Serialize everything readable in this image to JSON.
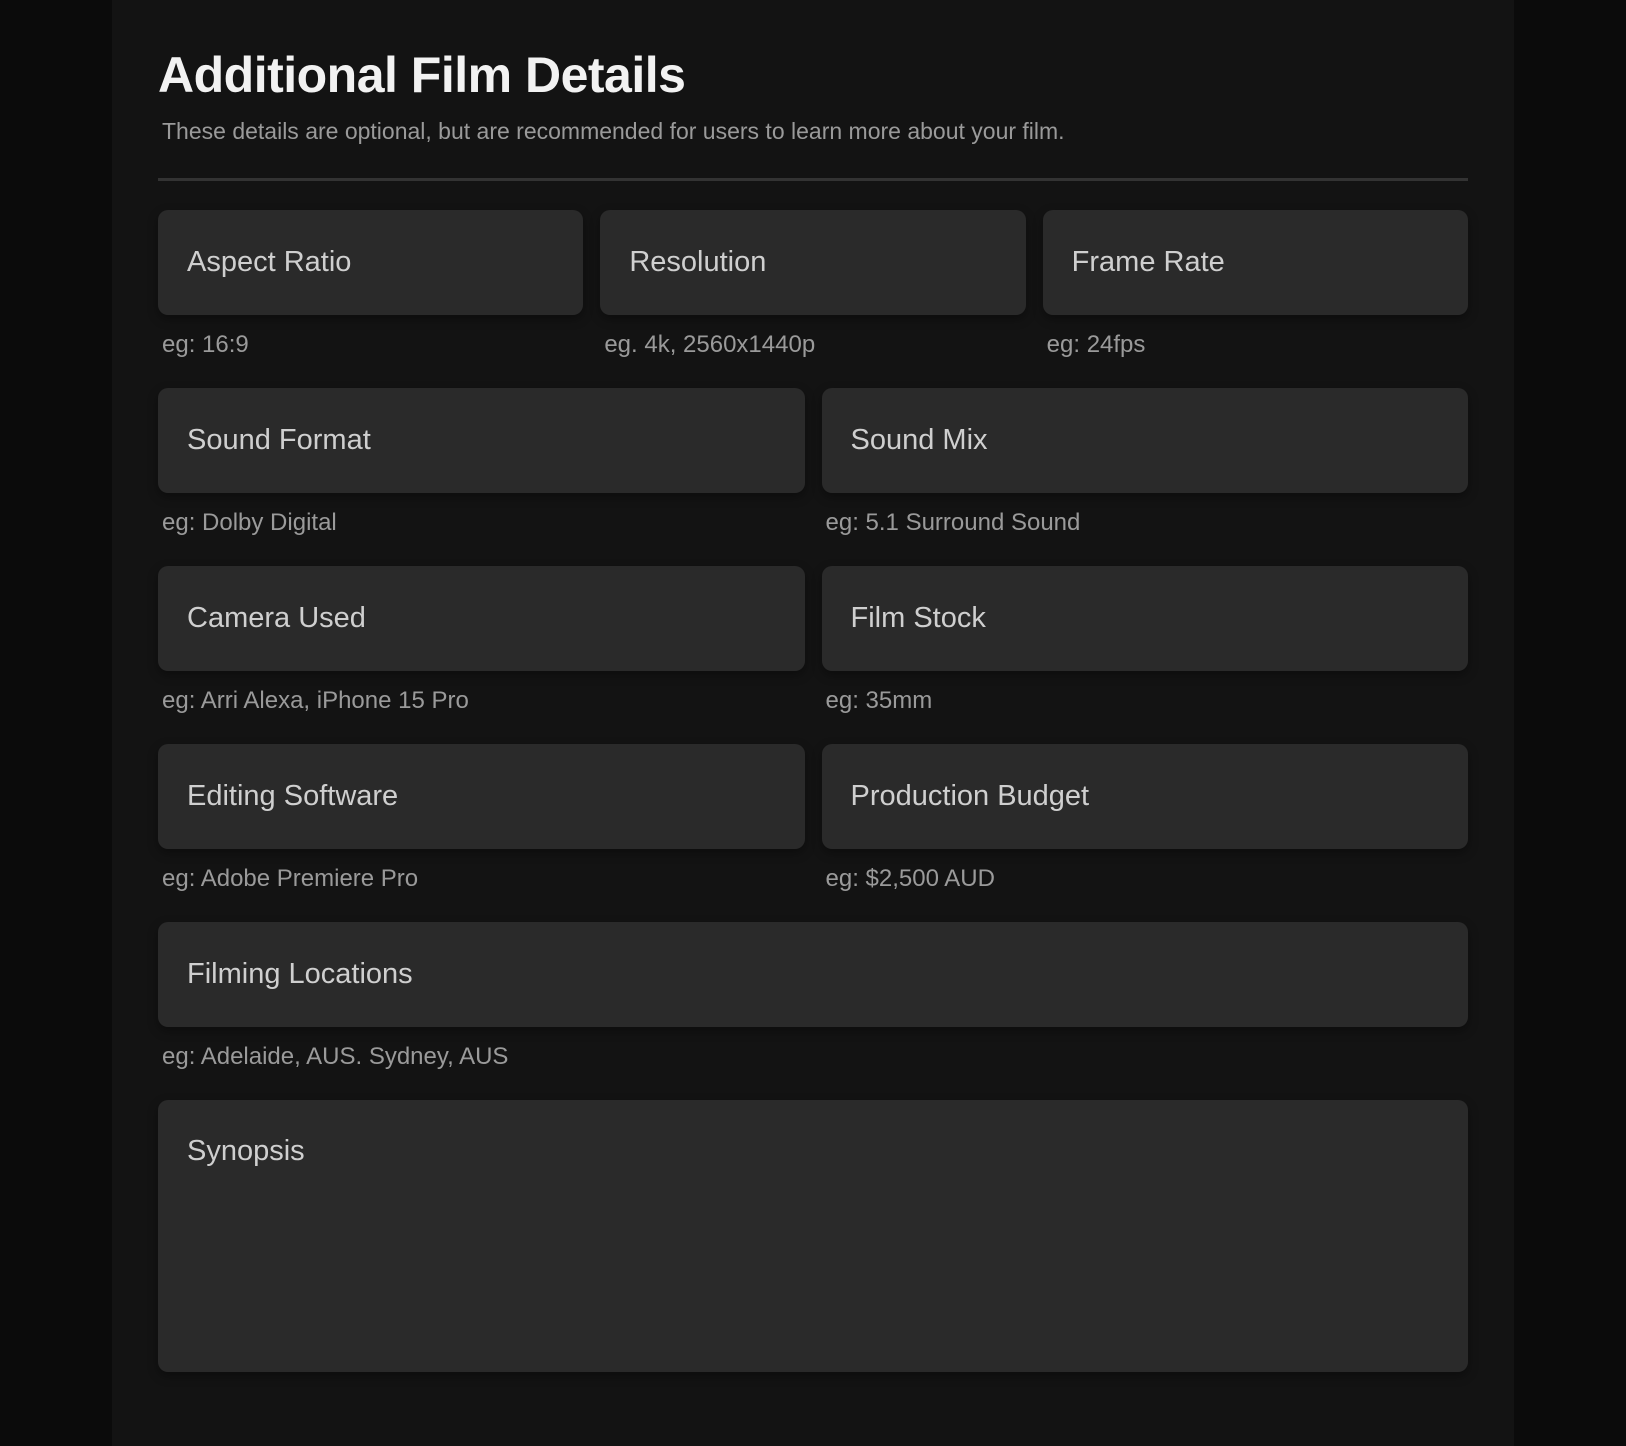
{
  "header": {
    "title": "Additional Film Details",
    "subtitle": "These details are optional, but are recommended for users to learn more about your film."
  },
  "fields": {
    "aspect_ratio": {
      "placeholder": "Aspect Ratio",
      "hint": "eg: 16:9"
    },
    "resolution": {
      "placeholder": "Resolution",
      "hint": "eg. 4k, 2560x1440p"
    },
    "frame_rate": {
      "placeholder": "Frame Rate",
      "hint": "eg: 24fps"
    },
    "sound_format": {
      "placeholder": "Sound Format",
      "hint": "eg: Dolby Digital"
    },
    "sound_mix": {
      "placeholder": "Sound Mix",
      "hint": "eg: 5.1 Surround Sound"
    },
    "camera_used": {
      "placeholder": "Camera Used",
      "hint": "eg: Arri Alexa, iPhone 15 Pro"
    },
    "film_stock": {
      "placeholder": "Film Stock",
      "hint": "eg: 35mm"
    },
    "editing_software": {
      "placeholder": "Editing Software",
      "hint": "eg: Adobe Premiere Pro"
    },
    "production_budget": {
      "placeholder": "Production Budget",
      "hint": "eg: $2,500 AUD"
    },
    "filming_locations": {
      "placeholder": "Filming Locations",
      "hint": "eg: Adelaide, AUS. Sydney, AUS"
    },
    "synopsis": {
      "placeholder": "Synopsis"
    }
  }
}
